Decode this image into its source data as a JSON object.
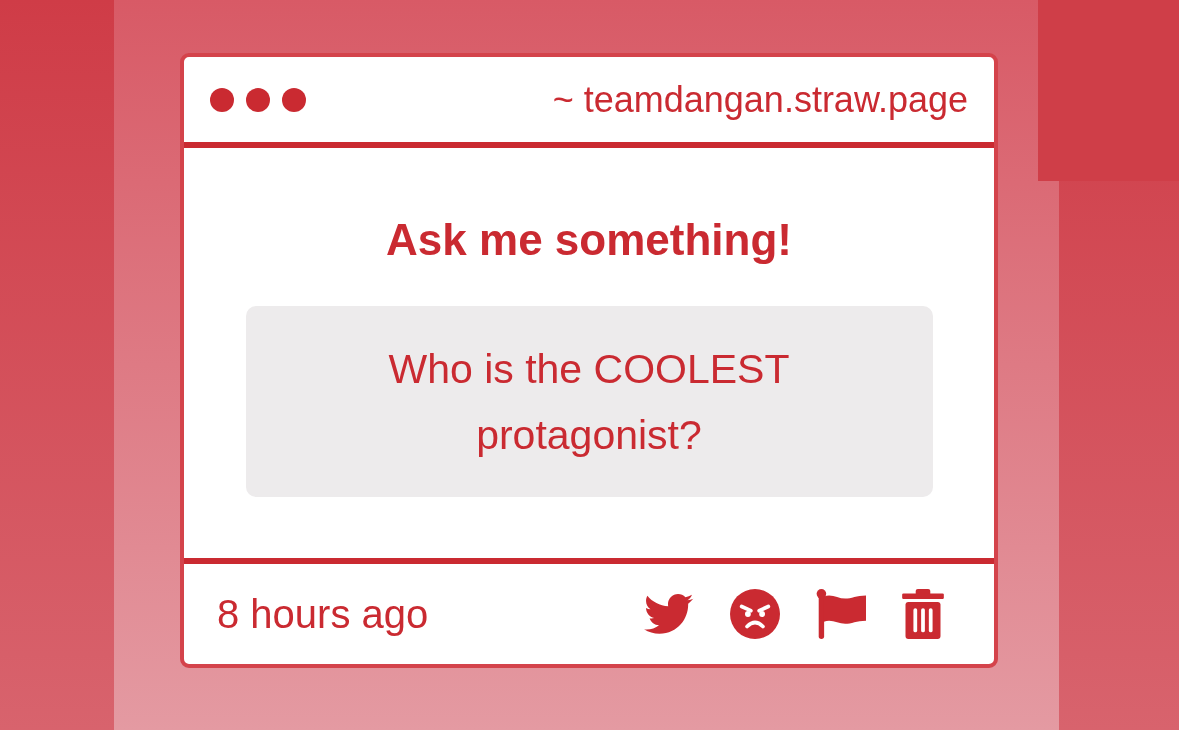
{
  "browser_bar": {
    "address": "~ teamdangan.straw.page"
  },
  "prompt": {
    "title": "Ask me something!",
    "question": "Who is the COOLEST protagonist?"
  },
  "footer": {
    "time": "8 hours ago"
  }
}
